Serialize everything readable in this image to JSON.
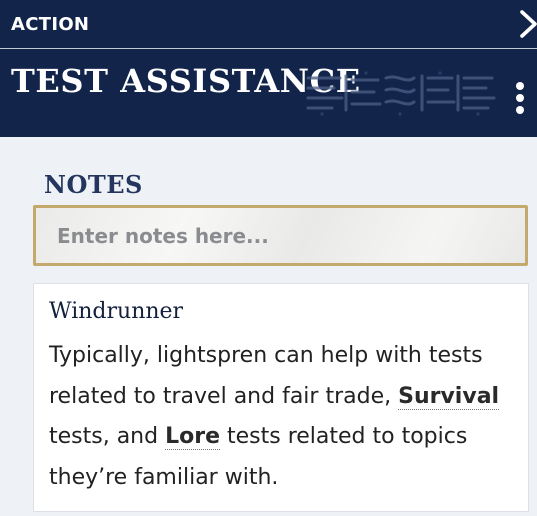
{
  "header": {
    "category": "ACTION",
    "title": "TEST ASSISTANCE",
    "close_icon": "chevron-right-icon",
    "menu_icon": "vertical-ellipsis-icon",
    "background_color": "#12244a"
  },
  "notes": {
    "label": "NOTES",
    "placeholder": "Enter notes here...",
    "value": "",
    "border_color": "#c4a96d"
  },
  "card": {
    "title": "Windrunner",
    "body": {
      "text_1": "Typically, lightspren can help with tests related to travel and fair trade, ",
      "link_1": "Survival",
      "text_2": " tests, and ",
      "link_2": "Lore",
      "text_3": " tests related to topics they’re familiar with."
    }
  }
}
